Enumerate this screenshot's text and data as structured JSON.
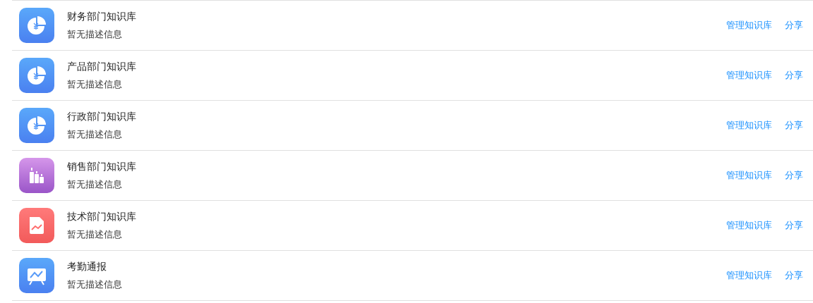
{
  "knowledge_bases": [
    {
      "kind": "pie",
      "title": "财务部门知识库",
      "description": "暂无描述信息",
      "manage": "管理知识库",
      "share": "分享"
    },
    {
      "kind": "pie",
      "title": "产品部门知识库",
      "description": "暂无描述信息",
      "manage": "管理知识库",
      "share": "分享"
    },
    {
      "kind": "pie",
      "title": "行政部门知识库",
      "description": "暂无描述信息",
      "manage": "管理知识库",
      "share": "分享"
    },
    {
      "kind": "bottles",
      "title": "销售部门知识库",
      "description": "暂无描述信息",
      "manage": "管理知识库",
      "share": "分享"
    },
    {
      "kind": "document",
      "title": "技术部门知识库",
      "description": "暂无描述信息",
      "manage": "管理知识库",
      "share": "分享"
    },
    {
      "kind": "presentation",
      "title": "考勤通报",
      "description": "暂无描述信息",
      "manage": "管理知识库",
      "share": "分享"
    }
  ]
}
